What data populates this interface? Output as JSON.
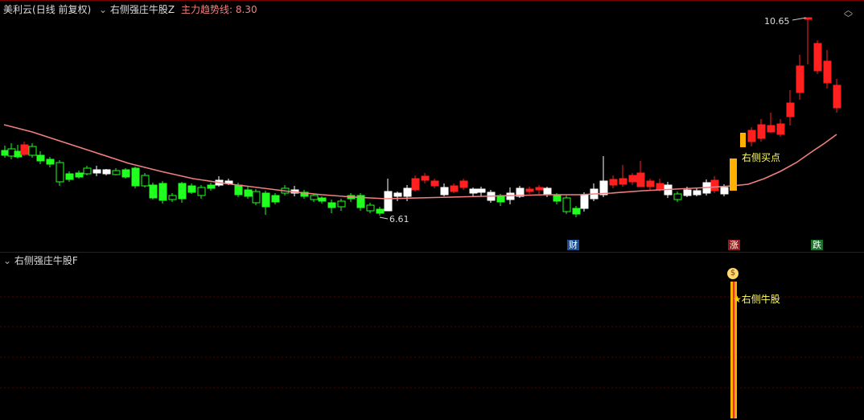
{
  "main_panel": {
    "stock_name": "美利云",
    "period": "(日线 前复权)",
    "indicator_name": "右侧强庄牛股Z",
    "trend_label": "主力趋势线:",
    "trend_value": "8.30",
    "high_label": "10.65",
    "low_label": "6.61",
    "buy_label": "右侧买点",
    "events": [
      {
        "label": "财",
        "color": "#2a6fd0"
      },
      {
        "label": "涨",
        "color": "#e03030"
      },
      {
        "label": "跌",
        "color": "#2aa040"
      }
    ]
  },
  "sub_panel": {
    "indicator_name": "右侧强庄牛股F",
    "signal_label": "右侧牛股",
    "star_glyph": "★",
    "bag_glyph": "$"
  },
  "controls": {
    "chevron_glyph": "⌄",
    "nav_up_glyph": "︿",
    "nav_down_glyph": "﹀"
  },
  "colors": {
    "up_body": "#ff2020",
    "down_body": "#20ff20",
    "neutral_body": "#ffffff",
    "trend_line": "#f08080",
    "signal_bar": "#ffb000",
    "grid": "#500000"
  },
  "chart_data": {
    "type": "candlestick",
    "min_price": 6.61,
    "max_price": 10.65
  }
}
